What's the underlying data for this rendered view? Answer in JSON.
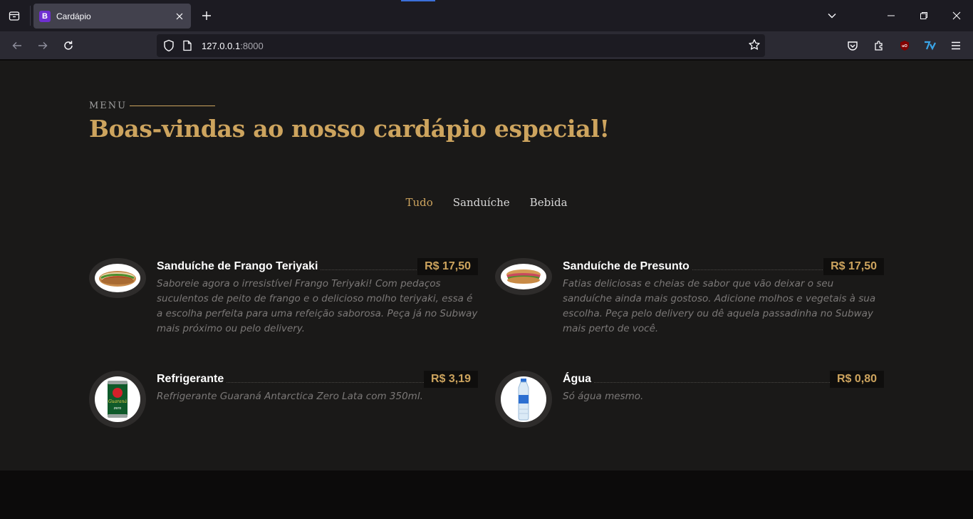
{
  "browser": {
    "tab_title": "Cardápio",
    "favicon_letter": "B",
    "url_host": "127.0.0.1",
    "url_port": ":8000"
  },
  "page": {
    "menu_label": "MENU",
    "title": "Boas-vindas ao nosso cardápio especial!",
    "filters": [
      "Tudo",
      "Sanduíche",
      "Bebida"
    ],
    "active_filter": "Tudo"
  },
  "items": [
    {
      "name": "Sanduíche de Frango Teriyaki",
      "price": "R$ 17,50",
      "description": "Saboreie agora o irresistível Frango Teriyaki! Com pedaços suculentos de peito de frango e o delicioso molho teriyaki, essa é a escolha perfeita para uma refeição saborosa. Peça já no Subway mais próximo ou pelo delivery."
    },
    {
      "name": "Sanduíche de Presunto",
      "price": "R$ 17,50",
      "description": "Fatias deliciosas e cheias de sabor que vão deixar o seu sanduíche ainda mais gostoso. Adicione molhos e vegetais à sua escolha. Peça pelo delivery ou dê aquela passadinha no Subway mais perto de você."
    },
    {
      "name": "Refrigerante",
      "price": "R$ 3,19",
      "description": "Refrigerante Guaraná Antarctica Zero Lata com 350ml."
    },
    {
      "name": "Água",
      "price": "R$ 0,80",
      "description": "Só água mesmo."
    }
  ],
  "colors": {
    "accent": "#cda45e",
    "page_bg": "#1a1918",
    "text": "#ffffff",
    "muted": "#7b7877"
  }
}
